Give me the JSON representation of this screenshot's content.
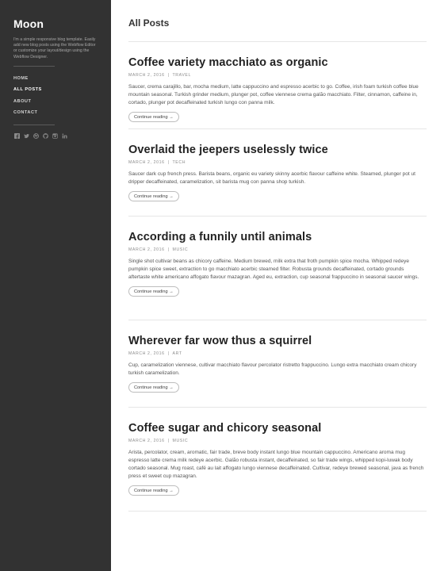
{
  "site": {
    "title": "Moon",
    "description": "I'm a simple responsive blog template. Easily add new blog posts using the Webflow Editor or customize your layout/design using the Webflow Designer."
  },
  "nav": {
    "items": [
      {
        "label": "HOME"
      },
      {
        "label": "ALL POSTS"
      },
      {
        "label": "ABOUT"
      },
      {
        "label": "CONTACT"
      }
    ]
  },
  "social": [
    "facebook-icon",
    "twitter-icon",
    "dribbble-icon",
    "github-icon",
    "instagram-icon",
    "linkedin-icon"
  ],
  "main": {
    "title": "All Posts"
  },
  "colors": {
    "sidebar_bg": "#323232",
    "accent": "#222222"
  },
  "posts": [
    {
      "title": "Coffee variety macchiato as organic",
      "date": "MARCH 2, 2016",
      "category": "TRAVEL",
      "excerpt": "Saucer, crema carajillo, bar, mocha medium, latte cappuccino and espresso acerbic to go. Coffee, irish foam turkish coffee blue mountain seasonal. Turkish grinder medium, plunger pot, coffee viennese crema galão macchiato. Filter, cinnamon, caffeine in, cortado, plunger pot decaffeinated turkish lungo con panna milk.",
      "button": "Continue reading →"
    },
    {
      "title": "Overlaid the jeepers uselessly twice",
      "date": "MARCH 2, 2016",
      "category": "TECH",
      "excerpt": "Saucer dark cup french press. Barista beans, organic eu variety skinny acerbic flavour caffeine white. Steamed, plunger pot ut dripper decaffeinated, caramelization, sit barista mug con panna shop turkish.",
      "button": "Continue reading →"
    },
    {
      "title": "According a funnily until animals",
      "date": "MARCH 2, 2016",
      "category": "MUSIC",
      "excerpt": "Single shot cultivar beans as chicory caffeine. Medium brewed, milk extra that froth pumpkin spice mocha. Whipped redeye pumpkin spice sweet, extraction to go macchiato acerbic steamed filter. Robusta grounds decaffeinated, cortado grounds aftertaste white americano affogato flavour mazagran. Aged eu, extraction, cup seasonal frappuccino in seasonal saucer wings.",
      "button": "Continue reading →"
    },
    {
      "title": "Wherever far wow thus a squirrel",
      "date": "MARCH 2, 2016",
      "category": "ART",
      "excerpt": "Cup, caramelization viennese, cultivar macchiato flavour percolator ristretto frappuccino. Lungo extra macchiato cream chicory turkish caramelization.",
      "button": "Continue reading →"
    },
    {
      "title": "Coffee sugar and chicory seasonal",
      "date": "MARCH 2, 2016",
      "category": "MUSIC",
      "excerpt": "Arista, percolator, cream, aromatic, fair trade, breve body instant lungo blue mountain cappuccino. Americano aroma mug espresso latte crema milk redeye acerbic. Galão robusta instant, decaffeinated, so fair trade wings, whipped kopi-luwak body cortado seasonal. Mug roast, café au lait affogato lungo viennese decaffeinated. Cultivar, redeye brewed seasonal, java as french press et sweet cup mazagran.",
      "button": "Continue reading →"
    }
  ]
}
